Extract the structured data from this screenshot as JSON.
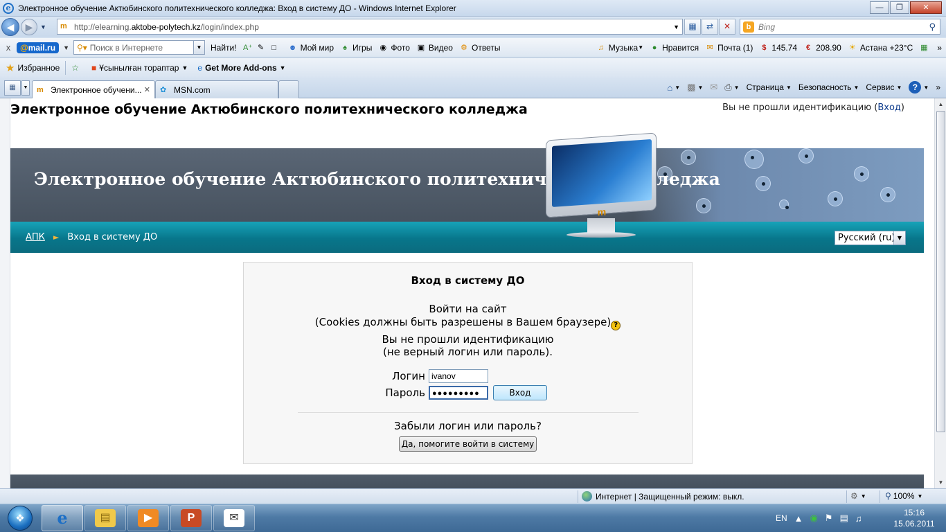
{
  "window": {
    "title": "Электронное обучение Актюбинского политехнического колледжа: Вход в систему ДО - Windows Internet Explorer"
  },
  "address_bar": {
    "url_prefix": "http://elearning.",
    "url_domain": "aktobe-polytech.kz",
    "url_path": "/login/index.php",
    "search_placeholder": "Bing"
  },
  "mail_toolbar": {
    "close_label": "x",
    "logo_prefix": "@",
    "logo_name": "mail.ru",
    "search_placeholder": "Поиск в Интернете",
    "find_label": "Найти!",
    "items": [
      {
        "label": "Мой мир"
      },
      {
        "label": "Игры"
      },
      {
        "label": "Фото"
      },
      {
        "label": "Видео"
      },
      {
        "label": "Ответы"
      }
    ],
    "right_items": [
      {
        "label": "Музыка"
      },
      {
        "label": "Нравится"
      },
      {
        "label": "Почта (1)"
      },
      {
        "label": "145.74"
      },
      {
        "label": "208.90"
      },
      {
        "label": "Астана +23°C"
      }
    ]
  },
  "favorites_bar": {
    "favorites_label": "Избранное",
    "suggested_label": "Ұсынылған тораптар",
    "addons_label": "Get More Add-ons"
  },
  "tabs": [
    {
      "label": "Электронное обучени...",
      "active": true
    },
    {
      "label": "MSN.com",
      "active": false
    }
  ],
  "command_bar": {
    "page_label": "Страница",
    "safety_label": "Безопасность",
    "tools_label": "Сервис",
    "help_label": "?"
  },
  "site": {
    "name": "Электронное обучение Актюбинского политехнического колледжа",
    "login_status_text": "Вы не прошли идентификацию (",
    "login_link": "Вход",
    "login_status_end": ")",
    "banner_title": "Электронное обучение Актюбинского политехнического колледжа",
    "breadcrumb_home": "АПК",
    "breadcrumb_sep": "►",
    "breadcrumb_current": "Вход в систему ДО",
    "language": "Русский (ru)"
  },
  "login": {
    "title": "Вход в систему ДО",
    "intro": "Войти на сайт",
    "cookies_note": "(Cookies должны быть разрешены в Вашем браузере)",
    "error_line1": "Вы не прошли идентификацию",
    "error_line2": "(не верный логин или пароль).",
    "username_label": "Логин",
    "username_value": "ivanov",
    "password_label": "Пароль",
    "password_value": "●●●●●●●●●",
    "submit_label": "Вход",
    "forgot_text": "Забыли логин или пароль?",
    "forgot_button": "Да, помогите войти в систему"
  },
  "status_bar": {
    "zone_text": "Интернет | Защищенный режим: выкл.",
    "zoom": "100%"
  },
  "taskbar": {
    "language": "EN",
    "time": "15:16",
    "date": "15.06.2011"
  }
}
